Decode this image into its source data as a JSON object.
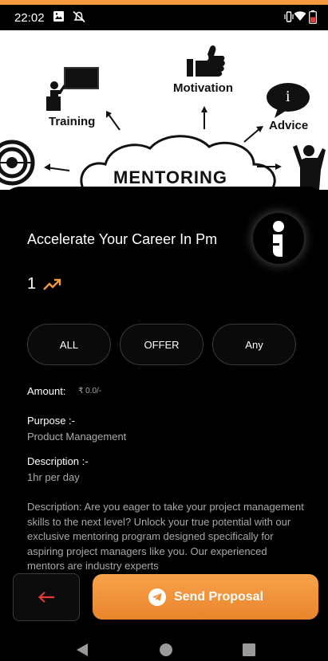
{
  "status_bar": {
    "time": "22:02"
  },
  "hero": {
    "labels": {
      "training": "Training",
      "motivation": "Motivation",
      "advice": "Advice",
      "mentoring": "MENTORING",
      "info_glyph": "i"
    }
  },
  "course": {
    "title": "Accelerate Your Career In Pm",
    "count": "1"
  },
  "filters": [
    "ALL",
    "OFFER",
    "Any"
  ],
  "details": {
    "amount_label": "Amount:",
    "amount_value": "₹ 0.0/-",
    "purpose_label": "Purpose :-",
    "purpose_value": "Product Management",
    "description_label": "Description :-",
    "description_value": "1hr per day",
    "long_description": "Description: Are you eager to take your project management skills to the next level? Unlock your true potential with our exclusive mentoring program designed specifically for aspiring project managers like you. Our experienced mentors are industry experts"
  },
  "actions": {
    "send_label": "Send Proposal"
  },
  "colors": {
    "accent": "#f29a3c",
    "back_arrow": "#e53935"
  }
}
